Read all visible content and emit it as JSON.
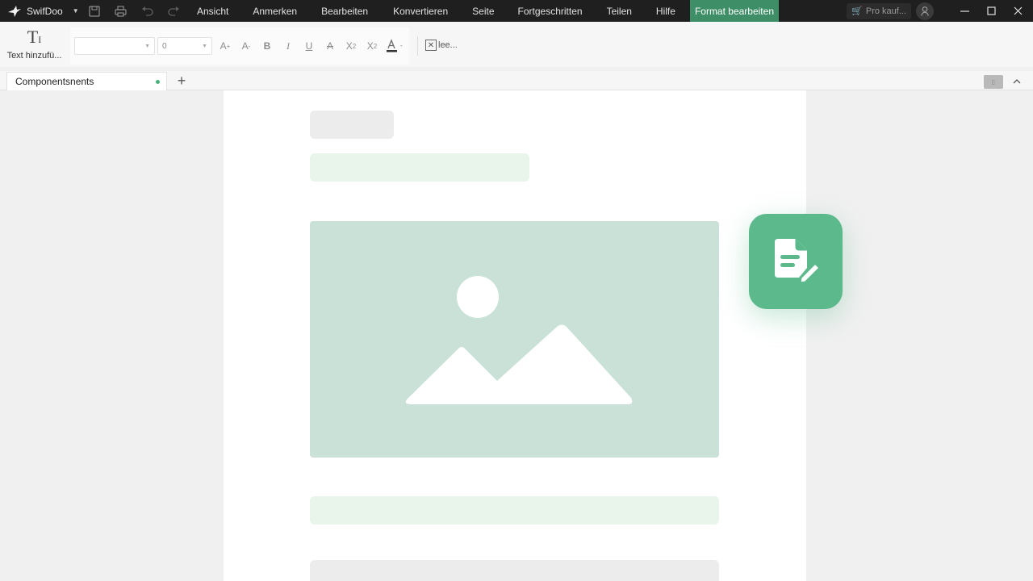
{
  "app": {
    "name": "SwifDoo",
    "logo_icon": "swifdoo-bird-icon"
  },
  "quick_access": [
    {
      "name": "save",
      "icon": "save-icon"
    },
    {
      "name": "print",
      "icon": "print-icon"
    },
    {
      "name": "undo",
      "icon": "undo-icon"
    },
    {
      "name": "redo",
      "icon": "redo-icon"
    }
  ],
  "menu": {
    "view": "Ansicht",
    "annotate": "Anmerken",
    "edit": "Bearbeiten",
    "convert": "Konvertieren",
    "page": "Seite",
    "advanced": "Fortgeschritten",
    "share": "Teilen",
    "help": "Hilfe",
    "format_edit": "Format bearbeiten"
  },
  "titlebar_right": {
    "pro_label": "Pro kauf...",
    "pro_icon": "cart-icon",
    "user_icon": "user-icon"
  },
  "ribbon": {
    "add_text_label": "Text hinzufü...",
    "font_name": "",
    "font_size": "0",
    "clear_label": "lee..."
  },
  "tabs": [
    {
      "label": "Componentsnents",
      "modified": true
    }
  ],
  "colors": {
    "accent": "#3e8f67",
    "titlebar": "#1f1f1f",
    "fab": "#5bb98c",
    "image_placeholder": "#c9e1d6",
    "tab_dot": "#47b27a"
  },
  "floating_icon": "document-edit-icon"
}
